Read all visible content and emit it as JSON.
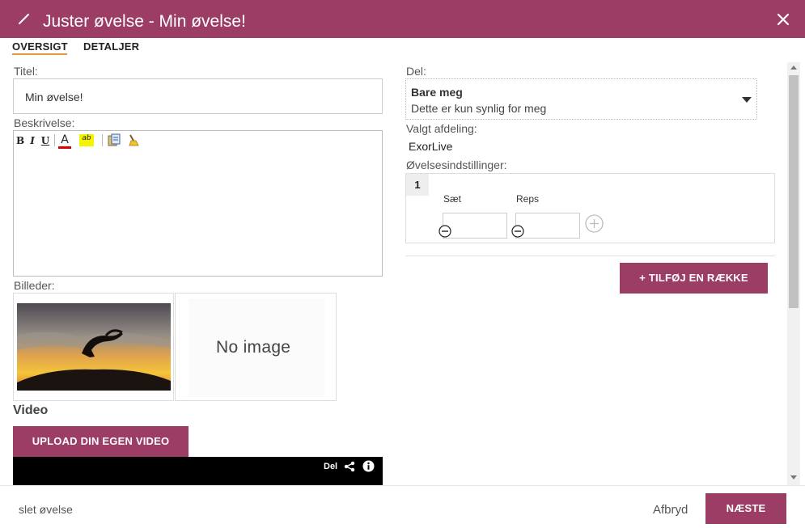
{
  "dialog": {
    "title": "Juster øvelse - Min øvelse!",
    "accent_color": "#9c3d65",
    "tab_underline_color": "#e19a35",
    "icons": {
      "edit": "pencil-icon",
      "close": "close-icon"
    }
  },
  "tabs": [
    {
      "label": "OVERSIGT",
      "active": true
    },
    {
      "label": "DETALJER",
      "active": false
    }
  ],
  "form": {
    "title_label": "Titel:",
    "title_value": "Min øvelse!",
    "description_label": "Beskrivelse:",
    "editor_toolbar": {
      "bold": "B",
      "italic": "I",
      "underline": "U",
      "font_color": "A",
      "highlight": "ab",
      "icons": [
        "bold-icon",
        "italic-icon",
        "underline-icon",
        "font-color-icon",
        "highlight-icon",
        "paste-icon",
        "clear-format-icon"
      ]
    },
    "images_label": "Billeder:",
    "images": [
      {
        "kind": "photo",
        "icon": "silhouette-photo"
      },
      {
        "kind": "placeholder",
        "text": "No image"
      }
    ],
    "video_heading": "Video",
    "upload_button": "UPLOAD DIN EGEN VIDEO",
    "video_share_label": "Del",
    "video_icons": [
      "share-icon",
      "info-icon"
    ]
  },
  "sharing": {
    "label": "Del:",
    "selected_title": "Bare meg",
    "selected_description": "Dette er kun synlig for meg"
  },
  "department": {
    "label": "Valgt afdeling:",
    "value": "ExorLive"
  },
  "exercise_settings": {
    "label": "Øvelsesindstillinger:",
    "rows": [
      {
        "number": "1",
        "sets_label": "Sæt",
        "reps_label": "Reps",
        "sets_value": "",
        "reps_value": ""
      }
    ],
    "add_row_button": "+ TILFØJ EN RÆKKE"
  },
  "footer": {
    "delete_link": "slet øvelse",
    "cancel_link": "Afbryd",
    "next_button": "NÆSTE"
  }
}
